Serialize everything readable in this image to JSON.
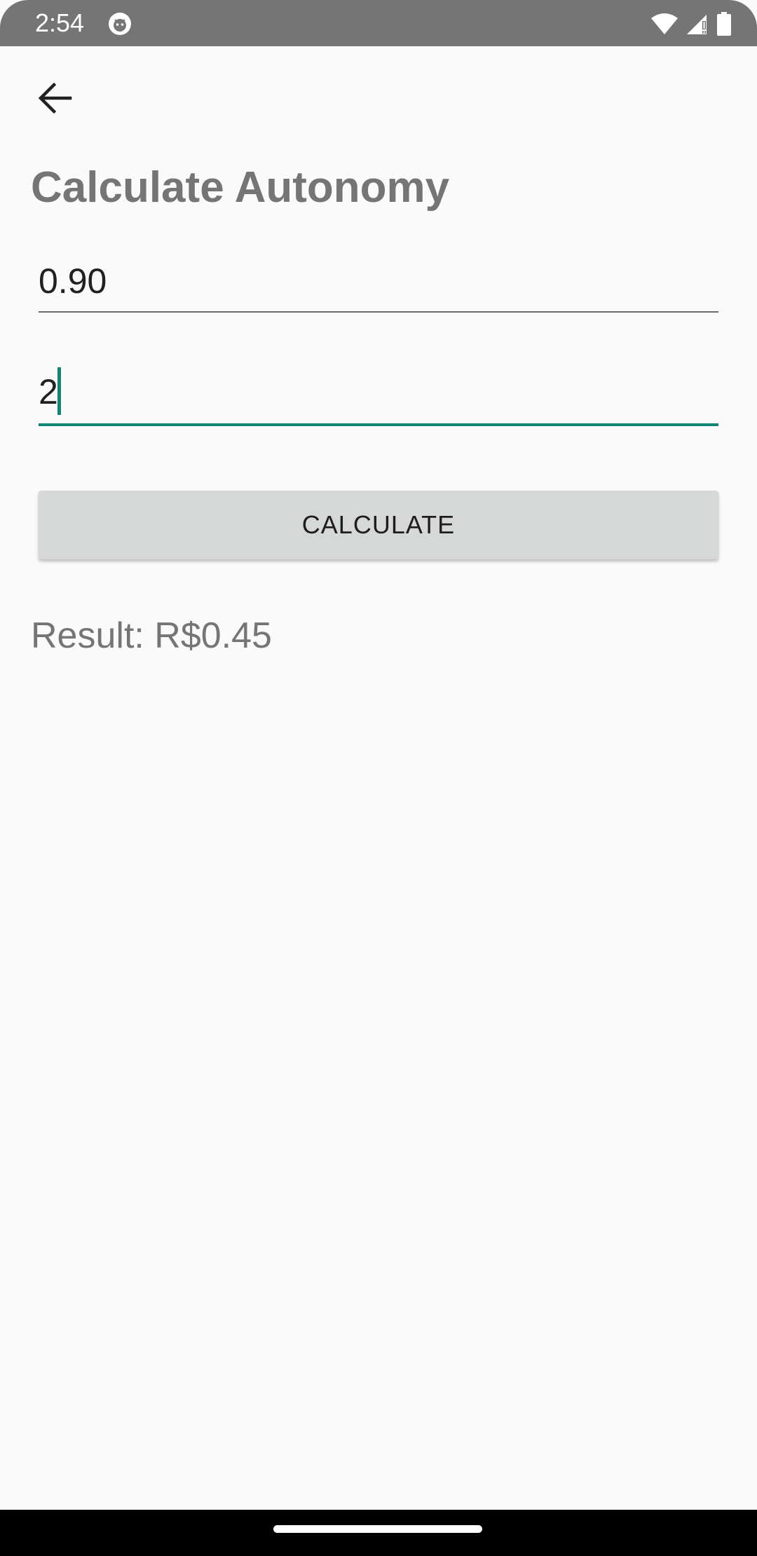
{
  "status_bar": {
    "time": "2:54",
    "app_icon": "android-debug-icon",
    "icons": [
      "wifi-icon",
      "cellular-signal-icon",
      "battery-icon"
    ]
  },
  "header": {
    "back_icon": "arrow-back-icon",
    "title": "Calculate Autonomy"
  },
  "form": {
    "amount_value": "0.90",
    "quantity_value": "2",
    "calculate_label": "CALCULATE"
  },
  "result": {
    "text": "Result: R$0.45"
  },
  "colors": {
    "accent": "#138577",
    "status_bar": "#757575",
    "background": "#fafafa",
    "button": "#d6d7d7"
  }
}
